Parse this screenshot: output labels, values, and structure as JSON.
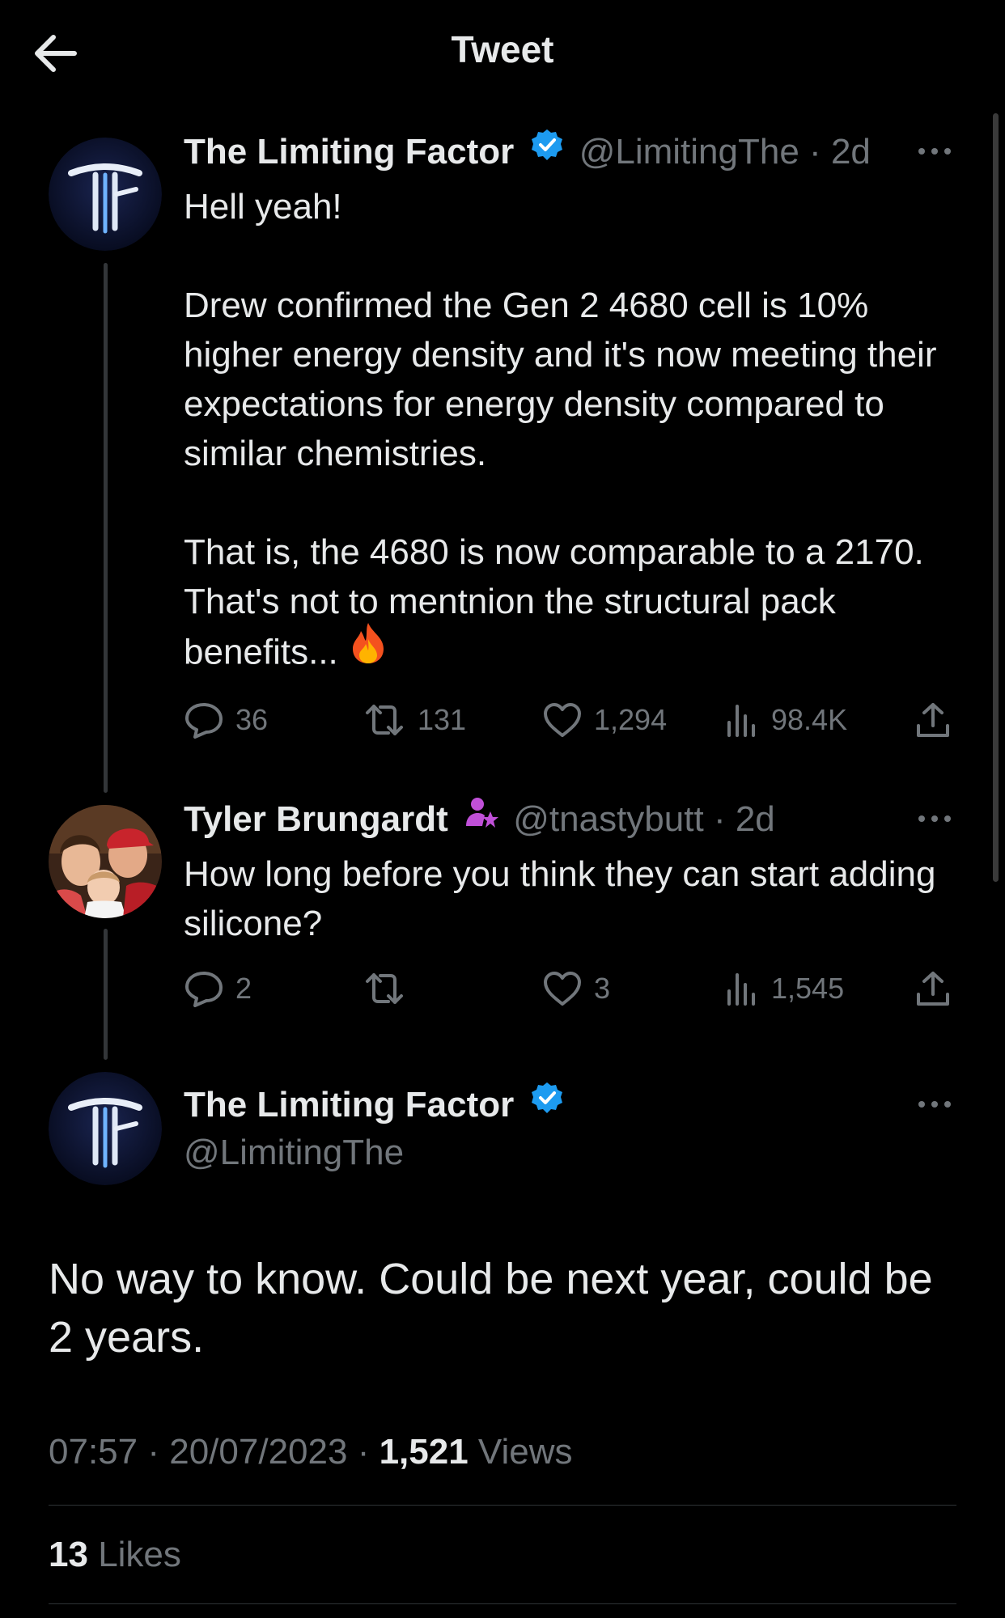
{
  "header": {
    "title": "Tweet"
  },
  "tweets": [
    {
      "author": "The Limiting Factor",
      "handle": "@LimitingThe",
      "sep": "·",
      "age": "2d",
      "paragraphs": [
        "Hell yeah!",
        "Drew confirmed the Gen 2 4680 cell is 10% higher energy density and it's now meeting their expectations for energy density compared to similar chemistries.",
        "That is, the 4680 is now comparable to a 2170.  That's not to mentnion the structural pack benefits..."
      ],
      "emoji": "fire-emoji",
      "stats": {
        "replies": "36",
        "retweets": "131",
        "likes": "1,294",
        "views": "98.4K"
      }
    },
    {
      "author": "Tyler Brungardt",
      "handle": "@tnastybutt",
      "sep": "·",
      "age": "2d",
      "paragraphs": [
        "How long before you think they can start adding silicone?"
      ],
      "stats": {
        "replies": "2",
        "retweets": "",
        "likes": "3",
        "views": "1,545"
      }
    }
  ],
  "main": {
    "author": "The Limiting Factor",
    "handle": "@LimitingThe",
    "text": "No way to know.  Could be next year, could be 2 years.",
    "time": "07:57",
    "sep": "·",
    "date": "20/07/2023",
    "views_count": "1,521",
    "views_label": "Views",
    "likes_count": "13",
    "likes_label": "Likes"
  },
  "colors": {
    "background": "#000000",
    "text": "#e7e9ea",
    "secondary": "#71767b",
    "verified": "#1d9bf0",
    "avatar_bg": "#0d1530"
  },
  "icons": [
    "back-arrow-icon",
    "verified-badge-icon",
    "more-icon",
    "reply-icon",
    "retweet-icon",
    "like-icon",
    "views-icon",
    "share-icon",
    "fire-emoji",
    "purple-user-badge-icon"
  ]
}
